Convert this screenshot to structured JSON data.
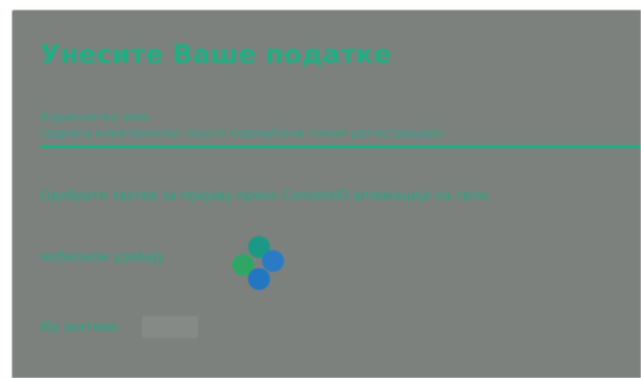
{
  "form": {
    "title": "Унесите Ваше податке",
    "username": {
      "label": "Корисничко име:",
      "hint": "(адреса електронске поште коришћена током регистрације)",
      "value": ""
    },
    "approval_message_line1": "Одобрите захтев за пријаву преко ConsentID апликације на свом",
    "approval_message_line2": "мобилном уређају",
    "request_id": {
      "label": "Ид захтева:",
      "value": ""
    }
  },
  "spinner": {
    "icon": "loading-spinner-icon",
    "colors": [
      "#1a9a86",
      "#30a664",
      "#2b7bc4",
      "#2277c2"
    ]
  },
  "colors": {
    "panel_background": "#7c817d",
    "accent": "#1fae82"
  }
}
